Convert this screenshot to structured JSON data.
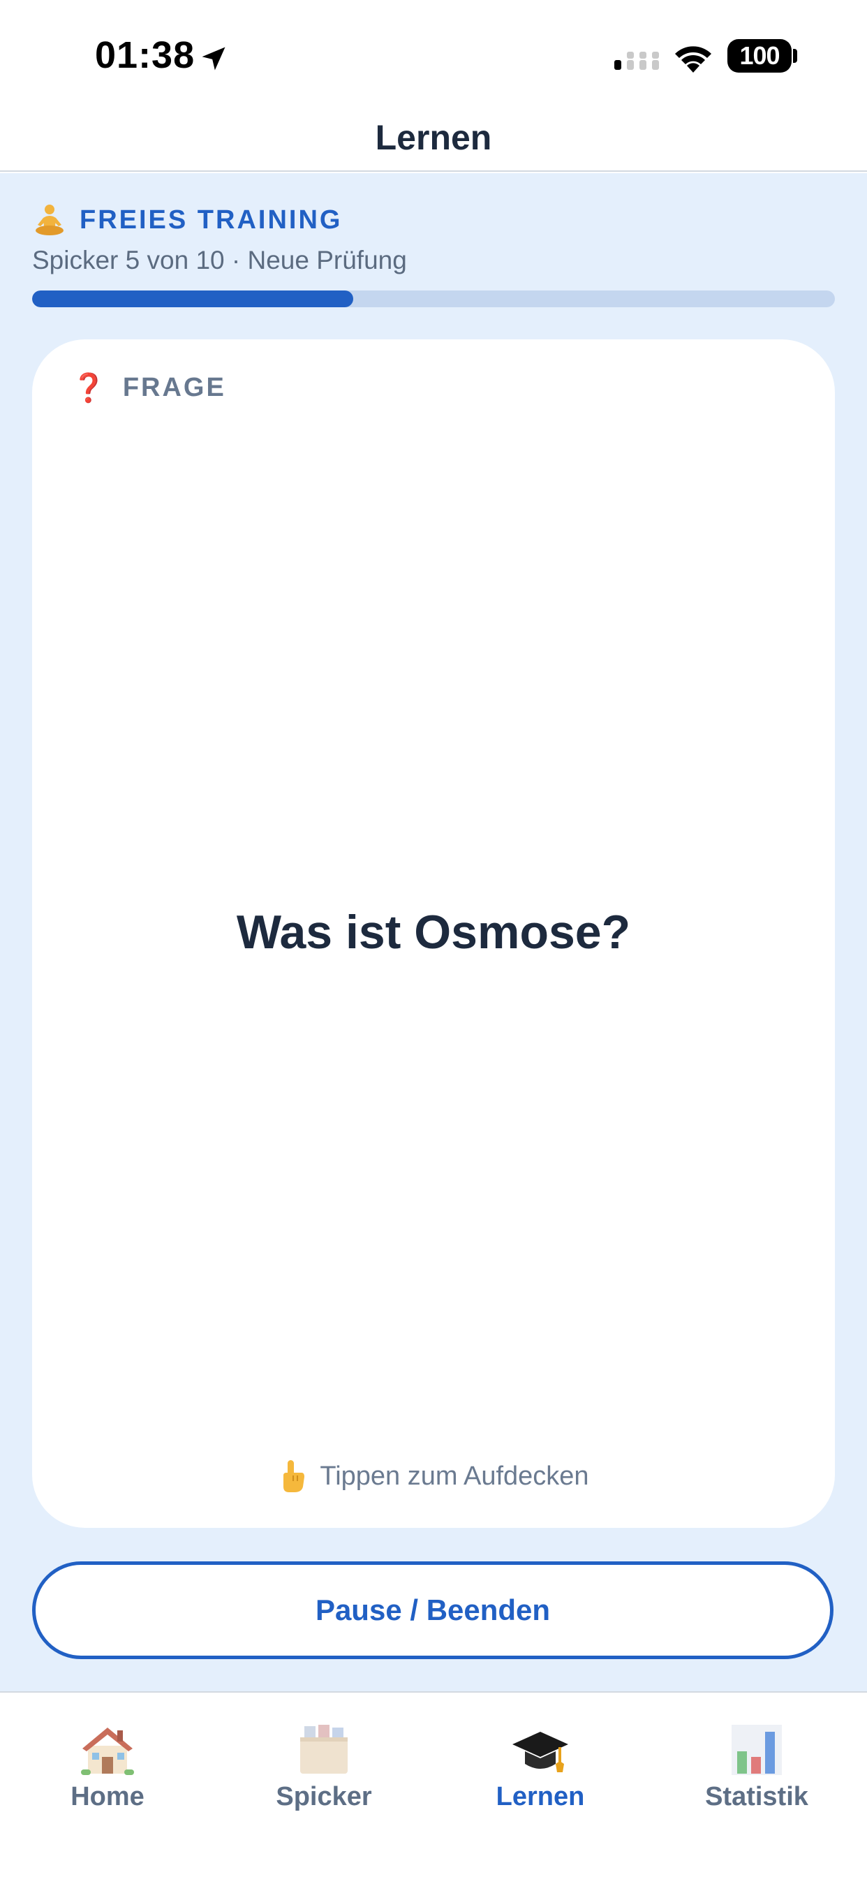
{
  "status_bar": {
    "time": "01:38",
    "battery": "100",
    "icons": [
      "location-arrow-icon",
      "cellular-signal-icon",
      "wifi-icon",
      "battery-icon"
    ]
  },
  "header": {
    "title": "Lernen"
  },
  "session": {
    "mode_icon": "person-meditating-icon",
    "mode_label": "FREIES TRAINING",
    "progress_text": "Spicker 5 von 10 · Neue Prüfung",
    "progress_fraction": 0.4
  },
  "card": {
    "type_icon": "question-mark-icon",
    "type_glyph": "❓",
    "type_label": "FRAGE",
    "question": "Was ist Osmose?",
    "hint_icon": "pointing-hand-icon",
    "hint": "Tippen zum Aufdecken"
  },
  "actions": {
    "pause_label": "Pause / Beenden"
  },
  "tabs": [
    {
      "label": "Home",
      "icon": "house-icon",
      "active": false
    },
    {
      "label": "Spicker",
      "icon": "card-box-icon",
      "active": false
    },
    {
      "label": "Lernen",
      "icon": "graduation-cap-icon",
      "active": true
    },
    {
      "label": "Statistik",
      "icon": "bar-chart-icon",
      "active": false
    }
  ],
  "colors": {
    "accent": "#2160c4",
    "background": "#e4effc",
    "text_dark": "#1d2a3e",
    "question_mark": "#c7101f"
  }
}
